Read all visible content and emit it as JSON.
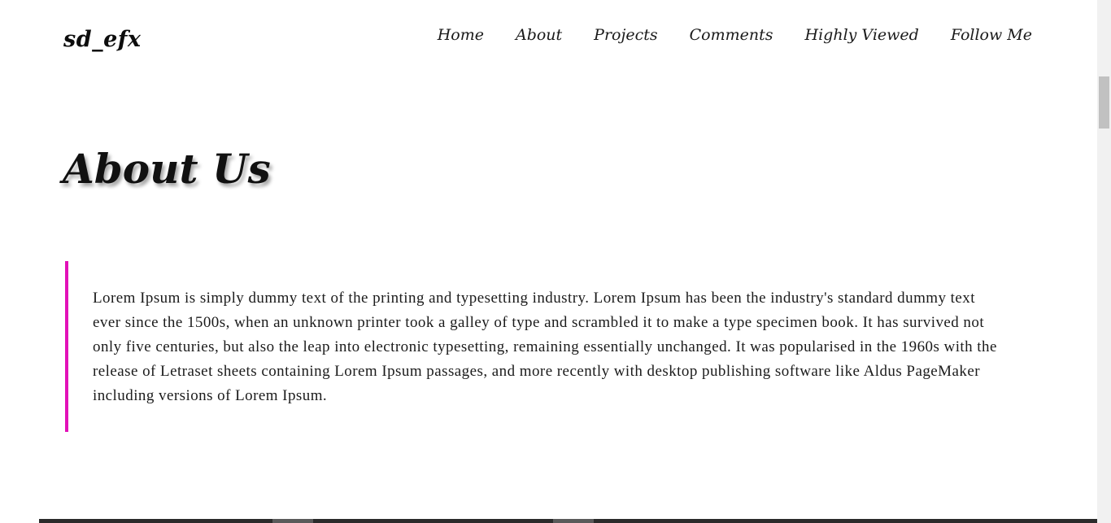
{
  "brand": "sd_efx",
  "nav": {
    "items": [
      {
        "label": "Home"
      },
      {
        "label": "About"
      },
      {
        "label": "Projects"
      },
      {
        "label": "Comments"
      },
      {
        "label": "Highly Viewed"
      },
      {
        "label": "Follow Me"
      }
    ]
  },
  "about": {
    "title": "About Us",
    "body": "Lorem Ipsum is simply dummy text of the printing and typesetting industry. Lorem Ipsum has been the industry's standard dummy text ever since the 1500s, when an unknown printer took a galley of type and scrambled it to make a type specimen book. It has survived not only five centuries, but also the leap into electronic typesetting, remaining essentially unchanged. It was popularised in the 1960s with the release of Letraset sheets containing Lorem Ipsum passages, and more recently with desktop publishing software like Aldus PageMaker including versions of Lorem Ipsum."
  },
  "colors": {
    "accent": "#e211b8",
    "text": "#111111",
    "background": "#ffffff"
  }
}
